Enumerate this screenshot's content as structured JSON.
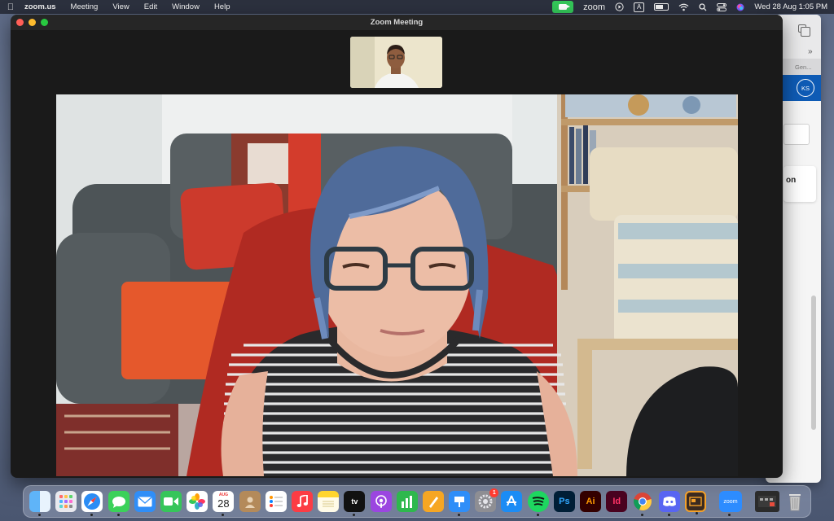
{
  "menubar": {
    "app_name": "zoom.us",
    "menus": [
      "Meeting",
      "View",
      "Edit",
      "Window",
      "Help"
    ],
    "status_zoom_label": "zoom",
    "input_badge": "A",
    "datetime": "Wed 28 Aug  1:05 PM"
  },
  "window": {
    "title": "Zoom Meeting"
  },
  "background_window": {
    "tab_text": "Gen...",
    "avatar_initials": "KS",
    "card_text": "on"
  },
  "dock": {
    "calendar_month": "AUG",
    "calendar_day": "28",
    "settings_badge": "1",
    "apps": [
      {
        "name": "finder-icon",
        "label": ""
      },
      {
        "name": "launchpad-icon",
        "label": ""
      },
      {
        "name": "safari-icon",
        "label": ""
      },
      {
        "name": "messages-icon",
        "label": ""
      },
      {
        "name": "mail-icon",
        "label": ""
      },
      {
        "name": "facetime-icon",
        "label": ""
      },
      {
        "name": "photos-icon",
        "label": ""
      },
      {
        "name": "calendar-icon",
        "label": ""
      },
      {
        "name": "contacts-icon",
        "label": ""
      },
      {
        "name": "reminders-icon",
        "label": ""
      },
      {
        "name": "music-icon",
        "label": ""
      },
      {
        "name": "notes-icon",
        "label": ""
      },
      {
        "name": "appletv-icon",
        "label": "tv"
      },
      {
        "name": "podcasts-icon",
        "label": ""
      },
      {
        "name": "numbers-icon",
        "label": ""
      },
      {
        "name": "pages-icon",
        "label": ""
      },
      {
        "name": "keynote-icon",
        "label": ""
      },
      {
        "name": "system-settings-icon",
        "label": ""
      },
      {
        "name": "app-store-icon",
        "label": ""
      },
      {
        "name": "spotify-icon",
        "label": ""
      },
      {
        "name": "photoshop-icon",
        "label": "Ps"
      },
      {
        "name": "illustrator-icon",
        "label": "Ai"
      },
      {
        "name": "indesign-icon",
        "label": "Id"
      },
      {
        "name": "chrome-icon",
        "label": ""
      },
      {
        "name": "discord-icon",
        "label": ""
      },
      {
        "name": "slides-icon",
        "label": ""
      },
      {
        "name": "zoom-icon",
        "label": "zoom"
      }
    ],
    "colors": {
      "zoom_green": "#34c759",
      "zoom_blue": "#2d8cff"
    }
  }
}
